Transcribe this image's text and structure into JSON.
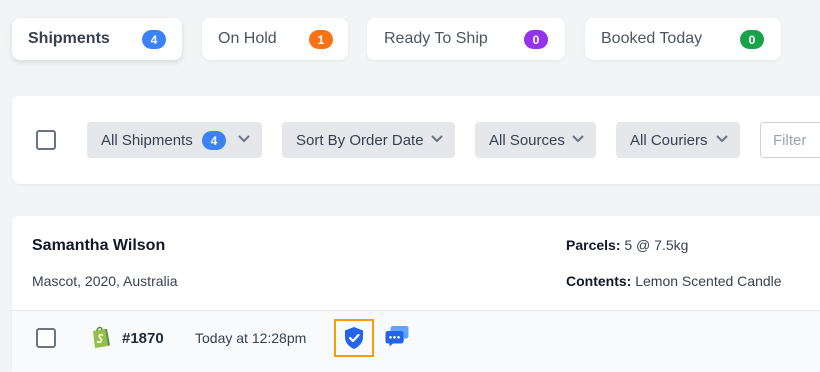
{
  "tabs": [
    {
      "label": "Shipments",
      "count": "4",
      "color": "#3b82f6",
      "active": true
    },
    {
      "label": "On Hold",
      "count": "1",
      "color": "#f97316"
    },
    {
      "label": "Ready To Ship",
      "count": "0",
      "color": "#9333ea"
    },
    {
      "label": "Booked Today",
      "count": "0",
      "color": "#16a34a"
    }
  ],
  "filters": {
    "shipments_label": "All Shipments",
    "shipments_count": "4",
    "sort_label": "Sort By Order Date",
    "sources_label": "All Sources",
    "couriers_label": "All Couriers",
    "filter_placeholder": "Filter",
    "filter_value": ""
  },
  "order": {
    "customer_name": "Samantha Wilson",
    "address": "Mascot, 2020, Australia",
    "parcels_label": "Parcels:",
    "parcels_value": "5 @ 7.5kg",
    "contents_label": "Contents:",
    "contents_value": "Lemon Scented Candle",
    "order_number": "#1870",
    "time": "Today at 12:28pm",
    "source_icon": "shopify-icon",
    "protection_icon": "shield-check-icon",
    "chat_icon": "chat-bubbles-icon"
  },
  "colors": {
    "accent_blue": "#3b82f6",
    "highlight_orange": "#f59e0b",
    "shopify_green": "#95bf47"
  }
}
